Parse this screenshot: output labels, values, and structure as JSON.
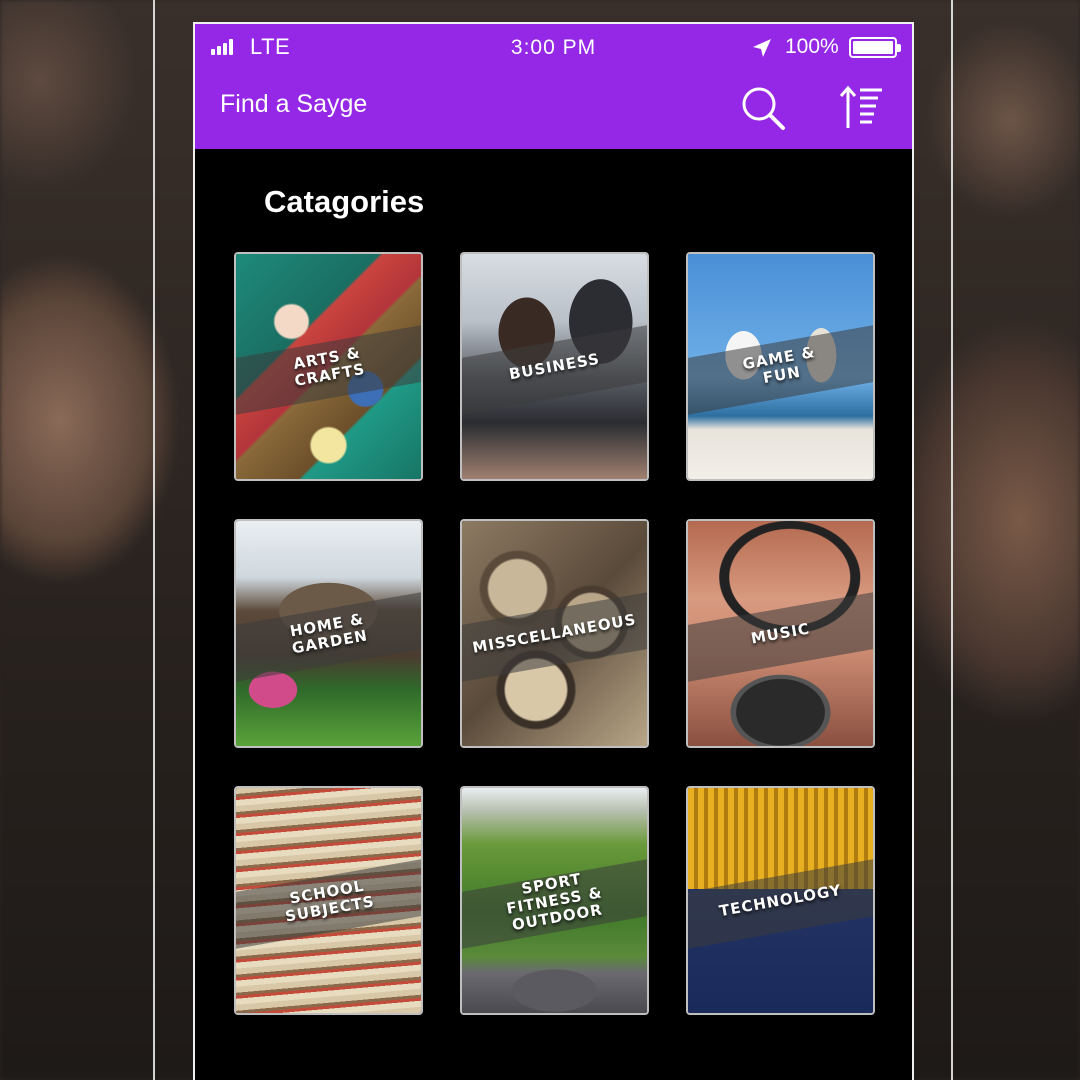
{
  "status_bar": {
    "carrier": "LTE",
    "time": "3:00 PM",
    "battery": "100%"
  },
  "header": {
    "title": "Find a Sayge",
    "search_icon": "search-icon",
    "sort_icon": "sort-icon"
  },
  "main": {
    "section_title": "Catagories",
    "categories": [
      {
        "label": "ARTS &\nCRAFTS"
      },
      {
        "label": "BUSINESS"
      },
      {
        "label": "GAME &\nFUN"
      },
      {
        "label": "HOME &\nGARDEN"
      },
      {
        "label": "MISSCELLANEOUS"
      },
      {
        "label": "MUSIC"
      },
      {
        "label": "SCHOOL\nSUBJECTS"
      },
      {
        "label": "SPORT\nFITNESS & OUTDOOR"
      },
      {
        "label": "TECHNOLOGY"
      }
    ]
  },
  "colors": {
    "accent": "#9527e6",
    "background": "#000000",
    "text": "#ffffff"
  }
}
